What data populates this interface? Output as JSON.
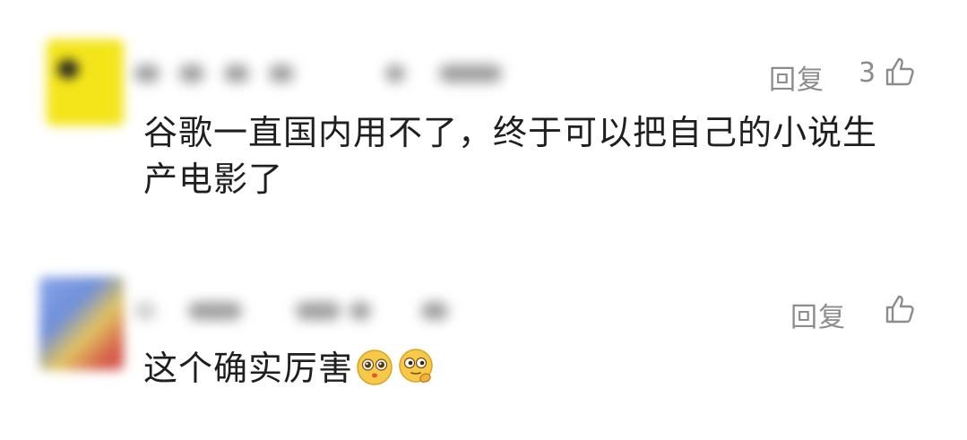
{
  "comments": [
    {
      "reply_label": "回复",
      "like_count": "3",
      "text_line1": "谷歌一直国内用不了，终于可以把自己的小说生",
      "text_line2": "产电影了",
      "avatar_color": "#f3e51a"
    },
    {
      "reply_label": "回复",
      "like_count": "",
      "text": "这个确实厉害",
      "emojis": [
        "pleading-face-emoji",
        "thinking-face-emoji"
      ]
    }
  ],
  "colors": {
    "meta_text": "#8c8c8c",
    "body_text": "#1f1f1f"
  }
}
